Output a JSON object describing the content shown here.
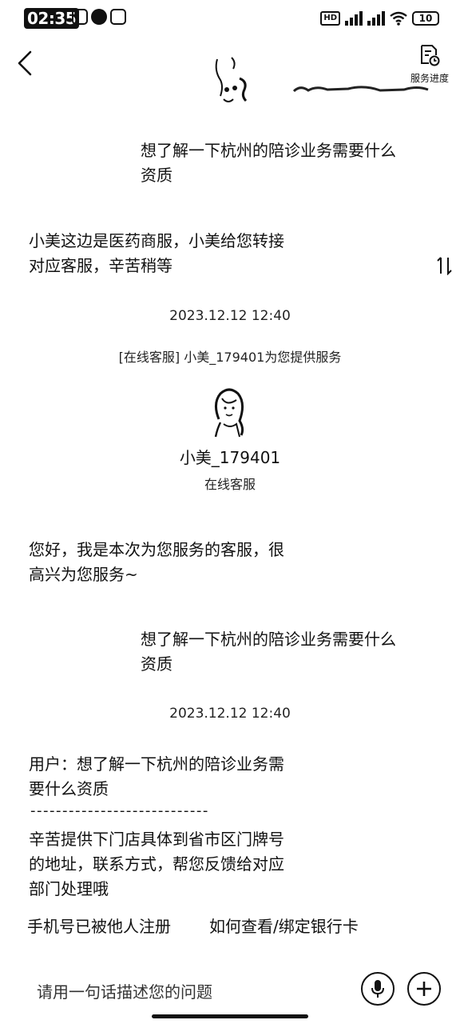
{
  "status_bar": {
    "time": "02:35",
    "network_badge": "HD",
    "battery_level": "10"
  },
  "header": {
    "progress_label": "服务进度"
  },
  "messages": {
    "user_question_1": "想了解一下杭州的陪诊业务需要什么\n资质",
    "bot_reply_1": "小美这边是医药商服，小美给您转接\n对应客服，辛苦稍等",
    "timestamp_1": "2023.12.12 12:40",
    "system_notice": "[在线客服] 小美_179401为您提供服务",
    "agent_name": "小美_179401",
    "agent_role": "在线客服",
    "agent_greeting": "您好，我是本次为您服务的客服，很\n高兴为您服务~",
    "user_question_2": "想了解一下杭州的陪诊业务需要什么\n资质",
    "timestamp_2": "2023.12.12 12:40",
    "agent_reply_quote": "用户：想了解一下杭州的陪诊业务需\n要什么资质",
    "divider": "----------------------------",
    "agent_reply_body": "辛苦提供下门店具体到省市区门牌号\n的地址，联系方式，帮您反馈给对应\n部门处理哦"
  },
  "quick_replies": [
    "手机号已被他人注册",
    "如何查看/绑定银行卡"
  ],
  "input": {
    "placeholder": "请用一句话描述您的问题"
  }
}
